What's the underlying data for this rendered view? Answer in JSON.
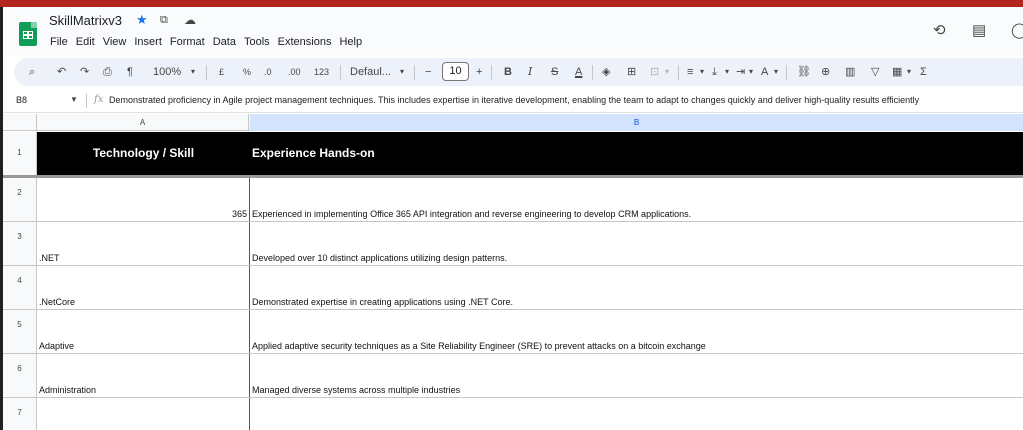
{
  "app": {
    "doc_title": "SkillMatrixv3",
    "menu": [
      "File",
      "Edit",
      "View",
      "Insert",
      "Format",
      "Data",
      "Tools",
      "Extensions",
      "Help"
    ],
    "accent_color": "#1a73e8",
    "icons": [
      "star-icon",
      "move-to-folder-icon",
      "cloud-saved-icon",
      "history-icon",
      "comments-icon"
    ]
  },
  "toolbar": {
    "zoom": "100%",
    "currency": "£",
    "percent": "%",
    "decrease_decimal": ".0",
    "increase_decimal": ".00",
    "number_format": "123",
    "font_family": "Defaul...",
    "font_size": "10",
    "minus": "−",
    "plus": "+",
    "bold": "B",
    "italic": "I",
    "strike": "S",
    "text_color": "A",
    "sum": "Σ"
  },
  "formula_bar": {
    "cell_ref": "B8",
    "formula_text": "Demonstrated proficiency in Agile project management techniques. This includes expertise in iterative development, enabling the team to adapt to changes quickly and deliver high-quality results efficiently"
  },
  "columns": [
    "A",
    "B"
  ],
  "sheet": {
    "header": {
      "row": "1",
      "col_a": "Technology / Skill",
      "col_b": "Experience Hands-on"
    },
    "rows": [
      {
        "row": "2",
        "skill": "365",
        "experience": "Experienced in implementing Office 365 API integration and reverse engineering to develop CRM applications."
      },
      {
        "row": "3",
        "skill": ".NET",
        "experience": "Developed over 10 distinct applications utilizing design patterns."
      },
      {
        "row": "4",
        "skill": ".NetCore",
        "experience": "Demonstrated expertise in creating applications using .NET Core."
      },
      {
        "row": "5",
        "skill": "Adaptive",
        "experience": "Applied adaptive security techniques as a Site Reliability Engineer (SRE) to prevent attacks on a bitcoin exchange"
      },
      {
        "row": "6",
        "skill": "Administration",
        "experience": "Managed diverse systems across multiple industries"
      },
      {
        "row": "7",
        "skill": "",
        "experience": ""
      }
    ]
  }
}
